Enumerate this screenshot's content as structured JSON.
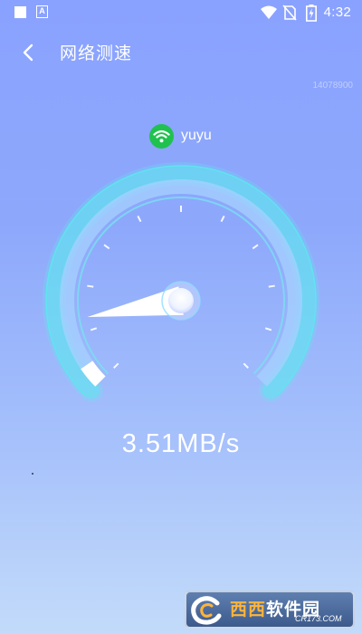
{
  "status_bar": {
    "time": "4:32",
    "icons": [
      "notification-square-icon",
      "a-icon",
      "wifi-icon",
      "no-sim-icon",
      "battery-charging-icon"
    ]
  },
  "header": {
    "title": "网络测速",
    "back_icon": "chevron-left-icon"
  },
  "build_id": "14078900",
  "network": {
    "name": "yuyu",
    "icon": "wifi-icon",
    "icon_color": "#1fc24f"
  },
  "gauge": {
    "progress_fraction": 0.04,
    "needle_fraction": 0.13
  },
  "speed": {
    "value": "3.51",
    "unit": "MB/s"
  },
  "watermark": {
    "text_main": "西西",
    "text_second": "软件园",
    "sub": "CR173.COM"
  },
  "colors": {
    "background_top": "#8aa2ff",
    "background_bottom": "#c3dbfa",
    "gauge_glow": "#5ee6ee",
    "wifi_green": "#1fc24f"
  }
}
